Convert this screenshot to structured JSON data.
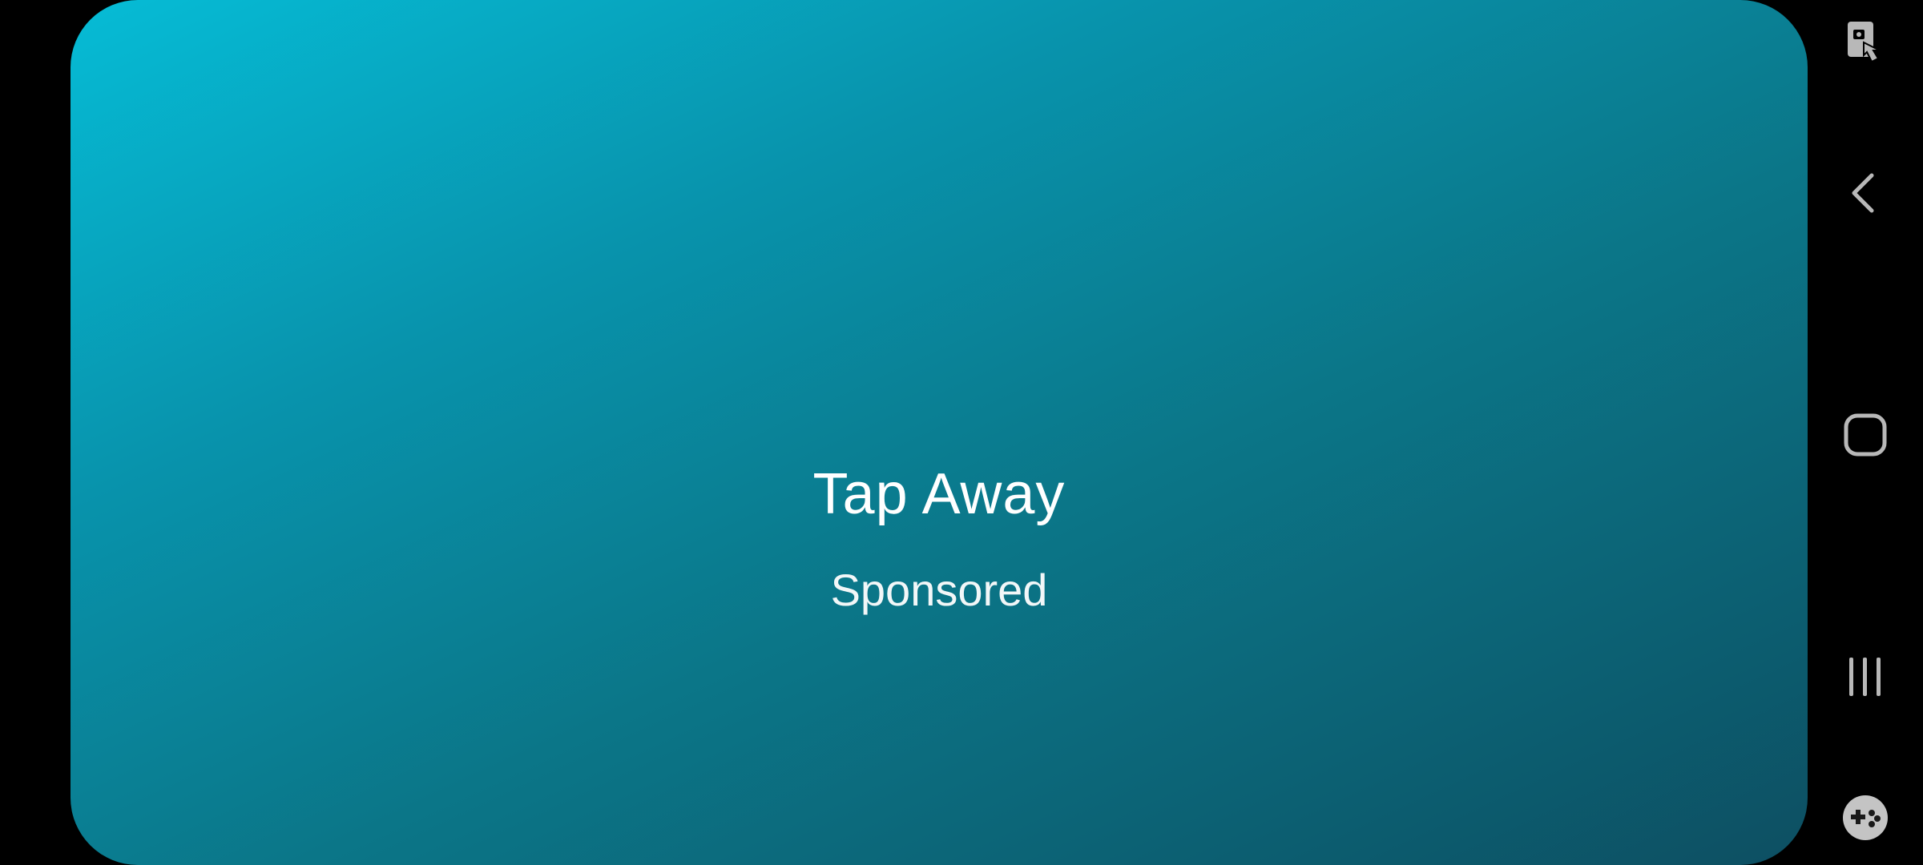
{
  "ad": {
    "title": "Tap Away",
    "label": "Sponsored"
  },
  "colors": {
    "gradient_start": "#06bcd6",
    "gradient_end": "#0d4f62",
    "nav_icon": "#b8b8b8",
    "nav_background": "#000000"
  },
  "navigation": {
    "items": [
      {
        "icon": "screen-pin-touch-icon"
      },
      {
        "icon": "back-chevron-icon"
      },
      {
        "icon": "home-icon"
      },
      {
        "icon": "recents-icon"
      },
      {
        "icon": "game-controller-icon"
      }
    ]
  }
}
